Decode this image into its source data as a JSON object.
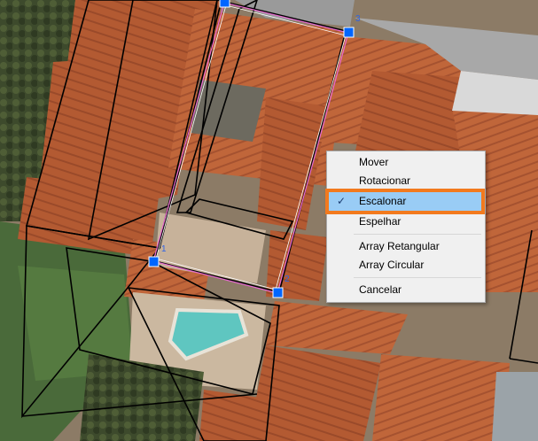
{
  "handles": [
    {
      "label": "1"
    },
    {
      "label": "2"
    },
    {
      "label": "3"
    }
  ],
  "context_menu": {
    "items": [
      {
        "label": "Mover",
        "checked": false
      },
      {
        "label": "Rotacionar",
        "checked": false
      },
      {
        "label": "Escalonar",
        "checked": true
      },
      {
        "label": "Espelhar",
        "checked": false
      },
      {
        "label": "Array Retangular",
        "checked": false
      },
      {
        "label": "Array Circular",
        "checked": false
      },
      {
        "label": "Cancelar",
        "checked": false
      }
    ],
    "check_glyph": "✓"
  },
  "colors": {
    "selection_highlight": "#99ccf5",
    "focus_outline": "#f27a1e",
    "handle_fill": "#0066ff",
    "selection_edge": "#e86ad0"
  }
}
